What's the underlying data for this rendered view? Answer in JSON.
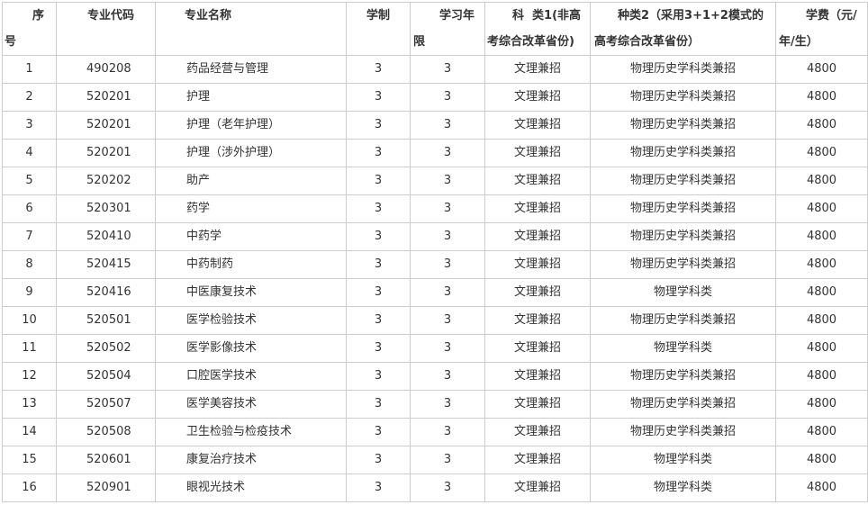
{
  "table": {
    "headers": {
      "seq_line1": "序",
      "seq_line2": "号",
      "code": "专业代码",
      "name": "专业名称",
      "years": "学制",
      "duration_line1": "学习年",
      "duration_line2": "限",
      "type1_line1": "科  类1(非高",
      "type1_line2": "考综合改革省份)",
      "type2_line1": "种类2（采用3+1+2模式的",
      "type2_line2": "高考综合改革省份）",
      "fee_line1": "学费（元/",
      "fee_line2": "年/生）"
    },
    "rows": [
      {
        "seq": "1",
        "code": "490208",
        "name": "药品经营与管理",
        "years": "3",
        "duration": "3",
        "type1": "文理兼招",
        "type2": "物理历史学科类兼招",
        "fee": "4800"
      },
      {
        "seq": "2",
        "code": "520201",
        "name": "护理",
        "years": "3",
        "duration": "3",
        "type1": "文理兼招",
        "type2": "物理历史学科类兼招",
        "fee": "4800"
      },
      {
        "seq": "3",
        "code": "520201",
        "name": "护理（老年护理）",
        "years": "3",
        "duration": "3",
        "type1": "文理兼招",
        "type2": "物理历史学科类兼招",
        "fee": "4800"
      },
      {
        "seq": "4",
        "code": "520201",
        "name": "护理（涉外护理）",
        "years": "3",
        "duration": "3",
        "type1": "文理兼招",
        "type2": "物理历史学科类兼招",
        "fee": "4800"
      },
      {
        "seq": "5",
        "code": "520202",
        "name": "助产",
        "years": "3",
        "duration": "3",
        "type1": "文理兼招",
        "type2": "物理历史学科类兼招",
        "fee": "4800"
      },
      {
        "seq": "6",
        "code": "520301",
        "name": "药学",
        "years": "3",
        "duration": "3",
        "type1": "文理兼招",
        "type2": "物理历史学科类兼招",
        "fee": "4800"
      },
      {
        "seq": "7",
        "code": "520410",
        "name": "中药学",
        "years": "3",
        "duration": "3",
        "type1": "文理兼招",
        "type2": "物理历史学科类兼招",
        "fee": "4800"
      },
      {
        "seq": "8",
        "code": "520415",
        "name": "中药制药",
        "years": "3",
        "duration": "3",
        "type1": "文理兼招",
        "type2": "物理历史学科类兼招",
        "fee": "4800"
      },
      {
        "seq": "9",
        "code": "520416",
        "name": "中医康复技术",
        "years": "3",
        "duration": "3",
        "type1": "文理兼招",
        "type2": "物理学科类",
        "fee": "4800"
      },
      {
        "seq": "10",
        "code": "520501",
        "name": "医学检验技术",
        "years": "3",
        "duration": "3",
        "type1": "文理兼招",
        "type2": "物理历史学科类兼招",
        "fee": "4800"
      },
      {
        "seq": "11",
        "code": "520502",
        "name": "医学影像技术",
        "years": "3",
        "duration": "3",
        "type1": "文理兼招",
        "type2": "物理学科类",
        "fee": "4800"
      },
      {
        "seq": "12",
        "code": "520504",
        "name": "口腔医学技术",
        "years": "3",
        "duration": "3",
        "type1": "文理兼招",
        "type2": "物理历史学科类兼招",
        "fee": "4800"
      },
      {
        "seq": "13",
        "code": "520507",
        "name": "医学美容技术",
        "years": "3",
        "duration": "3",
        "type1": "文理兼招",
        "type2": "物理历史学科类兼招",
        "fee": "4800"
      },
      {
        "seq": "14",
        "code": "520508",
        "name": "卫生检验与检疫技术",
        "years": "3",
        "duration": "3",
        "type1": "文理兼招",
        "type2": "物理历史学科类兼招",
        "fee": "4800"
      },
      {
        "seq": "15",
        "code": "520601",
        "name": "康复治疗技术",
        "years": "3",
        "duration": "3",
        "type1": "文理兼招",
        "type2": "物理学科类",
        "fee": "4800"
      },
      {
        "seq": "16",
        "code": "520901",
        "name": "眼视光技术",
        "years": "3",
        "duration": "3",
        "type1": "文理兼招",
        "type2": "物理学科类",
        "fee": "4800"
      }
    ]
  }
}
